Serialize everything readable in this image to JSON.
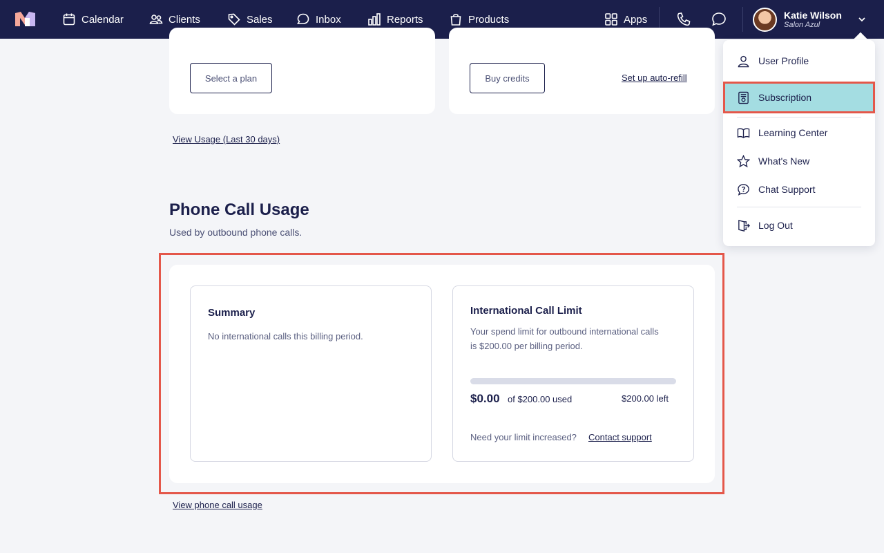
{
  "nav": {
    "items": [
      {
        "label": "Calendar",
        "icon": "calendar-icon"
      },
      {
        "label": "Clients",
        "icon": "clients-icon"
      },
      {
        "label": "Sales",
        "icon": "tag-icon"
      },
      {
        "label": "Inbox",
        "icon": "chat-bubble-icon"
      },
      {
        "label": "Reports",
        "icon": "bar-chart-icon"
      },
      {
        "label": "Products",
        "icon": "shopping-bag-icon"
      }
    ],
    "apps_label": "Apps",
    "user_name": "Katie Wilson",
    "salon_name": "Salon Azul"
  },
  "top_cards": {
    "select_plan_label": "Select a plan",
    "buy_credits_label": "Buy credits",
    "auto_refill_label": "Set up auto-refill",
    "view_usage_label": "View Usage (Last 30 days)"
  },
  "phone_usage": {
    "title": "Phone Call Usage",
    "subtitle": "Used by outbound phone calls.",
    "summary": {
      "title": "Summary",
      "text": "No international calls this billing period."
    },
    "intl": {
      "title": "International Call Limit",
      "description_line1": "Your spend limit for outbound international calls",
      "description_line2": "is $200.00 per billing period.",
      "used_amount": "$0.00",
      "used_of": "of $200.00 used",
      "left": "$200.00 left",
      "progress_fraction": 0,
      "need_increase": "Need your limit increased?",
      "contact_support": "Contact support"
    },
    "view_link": "View phone call usage"
  },
  "user_menu": {
    "items": [
      {
        "label": "User Profile",
        "icon": "user-icon"
      },
      {
        "label": "Subscription",
        "icon": "subscription-icon",
        "active": true
      },
      {
        "label": "Learning Center",
        "icon": "book-icon"
      },
      {
        "label": "What's New",
        "icon": "star-icon"
      },
      {
        "label": "Chat Support",
        "icon": "help-chat-icon"
      },
      {
        "label": "Log Out",
        "icon": "logout-icon"
      }
    ]
  },
  "colors": {
    "nav_bg": "#1b1f4b",
    "highlight": "#e4574a",
    "active_menu": "#a4dde2",
    "page_bg": "#f4f5f8"
  }
}
